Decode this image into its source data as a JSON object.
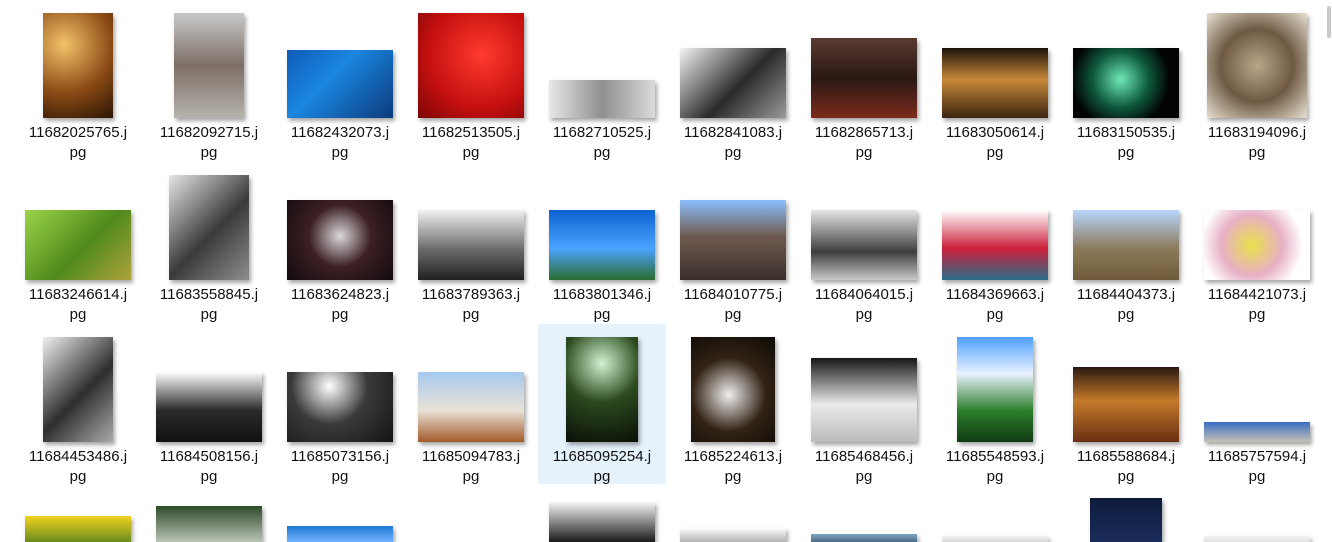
{
  "files": [
    {
      "line1": "11682025765.j",
      "line2": "pg",
      "thumb": {
        "w": 70,
        "h": 105,
        "bg": "radial-gradient(circle at 30% 30%, #f3c36a, #8a4a14 55%, #2a1406)"
      }
    },
    {
      "line1": "11682092715.j",
      "line2": "pg",
      "thumb": {
        "w": 70,
        "h": 105,
        "bg": "linear-gradient(180deg,#c9c9c9,#7d6f66 50%,#b6b3ad)"
      }
    },
    {
      "line1": "11682432073.j",
      "line2": "pg",
      "thumb": {
        "w": 106,
        "h": 68,
        "bg": "linear-gradient(135deg,#0e5bb8,#1b86e0 40%,#0b3b7c)"
      }
    },
    {
      "line1": "11682513505.j",
      "line2": "pg",
      "thumb": {
        "w": 106,
        "h": 105,
        "bg": "radial-gradient(circle at 60% 40%, #ff3b2e, #c40f0f 60%, #7a0606)"
      }
    },
    {
      "line1": "11682710525.j",
      "line2": "pg",
      "thumb": {
        "w": 106,
        "h": 38,
        "bg": "linear-gradient(90deg,#e8e8e8,#8f8f8f 50%,#dadada)"
      }
    },
    {
      "line1": "11682841083.j",
      "line2": "pg",
      "thumb": {
        "w": 106,
        "h": 70,
        "bg": "linear-gradient(135deg,#f4f4f4,#2a2a2a 55%,#9a9a9a)"
      }
    },
    {
      "line1": "11682865713.j",
      "line2": "pg",
      "thumb": {
        "w": 106,
        "h": 80,
        "bg": "linear-gradient(180deg,#5a3b30,#2a1814 50%,#7b2b1c)"
      }
    },
    {
      "line1": "11683050614.j",
      "line2": "pg",
      "thumb": {
        "w": 106,
        "h": 70,
        "bg": "linear-gradient(180deg,#1c1208,#c8893a 45%,#3b2410)"
      }
    },
    {
      "line1": "11683150535.j",
      "line2": "pg",
      "thumb": {
        "w": 106,
        "h": 70,
        "bg": "radial-gradient(circle at 45% 45%, #6fe8b7, #0e5a3d 40%, #020302 70%)"
      }
    },
    {
      "line1": "11683194096.j",
      "line2": "pg",
      "thumb": {
        "w": 100,
        "h": 105,
        "bg": "radial-gradient(circle, #b9a68a, #6e5a43 50%, #e9e1d3)"
      }
    },
    {
      "line1": "11683246614.j",
      "line2": "pg",
      "thumb": {
        "w": 106,
        "h": 70,
        "bg": "linear-gradient(135deg,#9bd44a,#4f8a1b 55%,#b0a23c)"
      }
    },
    {
      "line1": "11683558845.j",
      "line2": "pg",
      "thumb": {
        "w": 80,
        "h": 105,
        "bg": "linear-gradient(135deg,#e6e6e6,#3a3a3a 55%,#8e8e8e)"
      }
    },
    {
      "line1": "11683624823.j",
      "line2": "pg",
      "thumb": {
        "w": 106,
        "h": 80,
        "bg": "radial-gradient(circle at 50% 45%, #d9d9d9, #3c1f24 45%, #120a0c)"
      }
    },
    {
      "line1": "11683789363.j",
      "line2": "pg",
      "thumb": {
        "w": 106,
        "h": 70,
        "bg": "linear-gradient(180deg,#f2f2f2,#6d6d6d 55%,#202020)"
      }
    },
    {
      "line1": "11683801346.j",
      "line2": "pg",
      "thumb": {
        "w": 106,
        "h": 70,
        "bg": "linear-gradient(180deg,#0c62d1,#4ba3ff 55%,#2b6b2f)"
      }
    },
    {
      "line1": "11684010775.j",
      "line2": "pg",
      "thumb": {
        "w": 106,
        "h": 80,
        "bg": "linear-gradient(180deg,#8cc0ff,#6e5a4f 45%,#3a2f2a)"
      }
    },
    {
      "line1": "11684064015.j",
      "line2": "pg",
      "thumb": {
        "w": 106,
        "h": 70,
        "bg": "linear-gradient(180deg,#e6e6e6,#3d3d3d 60%,#c9c9c9)"
      }
    },
    {
      "line1": "11684369663.j",
      "line2": "pg",
      "thumb": {
        "w": 106,
        "h": 70,
        "bg": "linear-gradient(180deg,#ffffff,#cc1f3b 55%,#2a6f8a)"
      }
    },
    {
      "line1": "11684404373.j",
      "line2": "pg",
      "thumb": {
        "w": 106,
        "h": 70,
        "bg": "linear-gradient(180deg,#b8d5ff,#8b7a5a 55%,#6e5a39)"
      }
    },
    {
      "line1": "11684421073.j",
      "line2": "pg",
      "thumb": {
        "w": 106,
        "h": 70,
        "bg": "radial-gradient(circle at 45% 50%, #e9e04b, #e7b0c6 45%, #ffffff 75%)"
      }
    },
    {
      "line1": "11684453486.j",
      "line2": "pg",
      "thumb": {
        "w": 70,
        "h": 105,
        "bg": "linear-gradient(135deg,#f0f0f0,#2e2e2e 55%,#aaaaaa)"
      }
    },
    {
      "line1": "11684508156.j",
      "line2": "pg",
      "thumb": {
        "w": 106,
        "h": 70,
        "bg": "linear-gradient(180deg,#ffffff,#2a2a2a 55%,#111111)"
      }
    },
    {
      "line1": "11685073156.j",
      "line2": "pg",
      "thumb": {
        "w": 106,
        "h": 70,
        "bg": "radial-gradient(circle at 40% 20%, #ffffff, #3a3a3a 45%, #141414)"
      }
    },
    {
      "line1": "11685094783.j",
      "line2": "pg",
      "thumb": {
        "w": 106,
        "h": 70,
        "bg": "linear-gradient(180deg,#a6c9ef,#e8e2d7 55%,#a25a2a)"
      }
    },
    {
      "line1": "11685095254.j",
      "line2": "pg",
      "thumb": {
        "w": 72,
        "h": 105,
        "bg": "radial-gradient(circle at 50% 25%, #d0f3cf, #2b4a1e 45%, #0a0f06)"
      }
    },
    {
      "line1": "11685224613.j",
      "line2": "pg",
      "thumb": {
        "w": 84,
        "h": 105,
        "bg": "radial-gradient(circle at 45% 55%, #f0eeee, #312214 50%, #0e0a06)"
      }
    },
    {
      "line1": "11685468456.j",
      "line2": "pg",
      "thumb": {
        "w": 106,
        "h": 84,
        "bg": "linear-gradient(180deg,#151515,#eaeaea 55%,#bbbbbb)"
      }
    },
    {
      "line1": "11685548593.j",
      "line2": "pg",
      "thumb": {
        "w": 76,
        "h": 105,
        "bg": "linear-gradient(180deg,#4f9fff,#e9f2ff 35%,#2c7f2b 70%,#0f3a13)"
      }
    },
    {
      "line1": "11685588684.j",
      "line2": "pg",
      "thumb": {
        "w": 106,
        "h": 75,
        "bg": "linear-gradient(180deg,#2a1812,#c57a2a 45%,#6a2f12)"
      }
    },
    {
      "line1": "11685757594.j",
      "line2": "pg",
      "thumb": {
        "w": 106,
        "h": 20,
        "bg": "linear-gradient(180deg,#3a6cc4,#c6c2b4)"
      }
    }
  ],
  "bottom_row": [
    {
      "w": 106,
      "h": 26,
      "bg": "linear-gradient(180deg,#f2d21f,#6a8b1d)"
    },
    {
      "w": 106,
      "h": 36,
      "bg": "linear-gradient(180deg,#2f4a2a,#b9c4b5)"
    },
    {
      "w": 106,
      "h": 16,
      "bg": "linear-gradient(180deg,#1d77d4,#72b3ff)"
    },
    {
      "w": 106,
      "h": 0,
      "bg": "#ffffff"
    },
    {
      "w": 106,
      "h": 40,
      "bg": "linear-gradient(180deg,#f6f6f6,#1a1a1a)"
    },
    {
      "w": 106,
      "h": 14,
      "bg": "linear-gradient(180deg,#ffffff,#b2b2b2)"
    },
    {
      "w": 106,
      "h": 8,
      "bg": "linear-gradient(180deg,#7fa6c7,#4c6a86)"
    },
    {
      "w": 106,
      "h": 6,
      "bg": "linear-gradient(180deg,#f2f2f2,#d8d8d8)"
    },
    {
      "w": 72,
      "h": 44,
      "bg": "linear-gradient(180deg,#0d1a3a,#1a2c5a)"
    },
    {
      "w": 106,
      "h": 6,
      "bg": "linear-gradient(180deg,#f2f2f2,#e0e0e0)"
    }
  ],
  "selected_index": 24
}
